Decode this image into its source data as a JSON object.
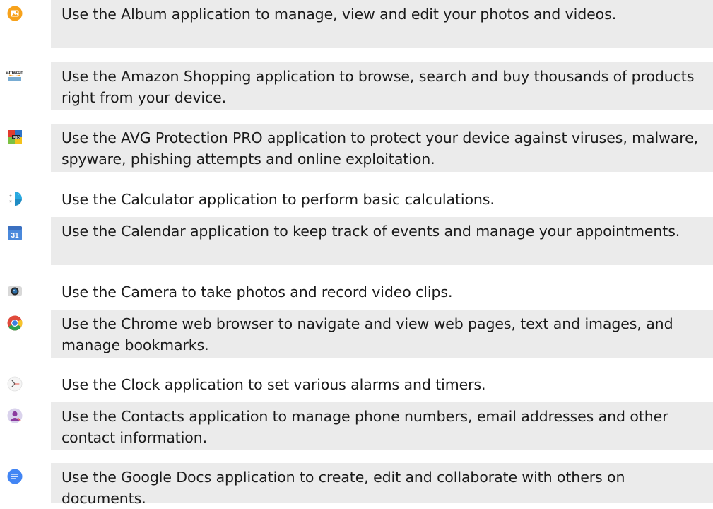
{
  "apps": [
    {
      "icon": "album-icon",
      "description": "Use the Album application to manage, view and edit your photos and videos."
    },
    {
      "icon": "amazon-icon",
      "description": "Use the Amazon Shopping application to browse, search and buy thousands of products right from your device."
    },
    {
      "icon": "avg-protection-icon",
      "description": "Use the AVG Protection PRO application to protect your device against viruses, malware, spyware, phishing attempts and online exploitation."
    },
    {
      "icon": "calculator-icon",
      "description": "Use the Calculator application to perform basic calculations."
    },
    {
      "icon": "calendar-icon",
      "label": "31",
      "description": "Use the Calendar application to keep track of events and manage your appointments."
    },
    {
      "icon": "camera-icon",
      "description": "Use the Camera to take photos and record video clips."
    },
    {
      "icon": "chrome-icon",
      "description": "Use the Chrome web browser to navigate and view web pages, text and images, and manage bookmarks."
    },
    {
      "icon": "clock-icon",
      "description": "Use the Clock application to set various alarms and timers."
    },
    {
      "icon": "contacts-icon",
      "description": "Use the Contacts application to manage phone numbers, email addresses and other contact information."
    },
    {
      "icon": "google-docs-icon",
      "description": "Use the Google Docs application to create, edit and collaborate with others on documents."
    }
  ],
  "colors": {
    "row_background": "#ebebeb",
    "text": "#1a1a1a"
  }
}
